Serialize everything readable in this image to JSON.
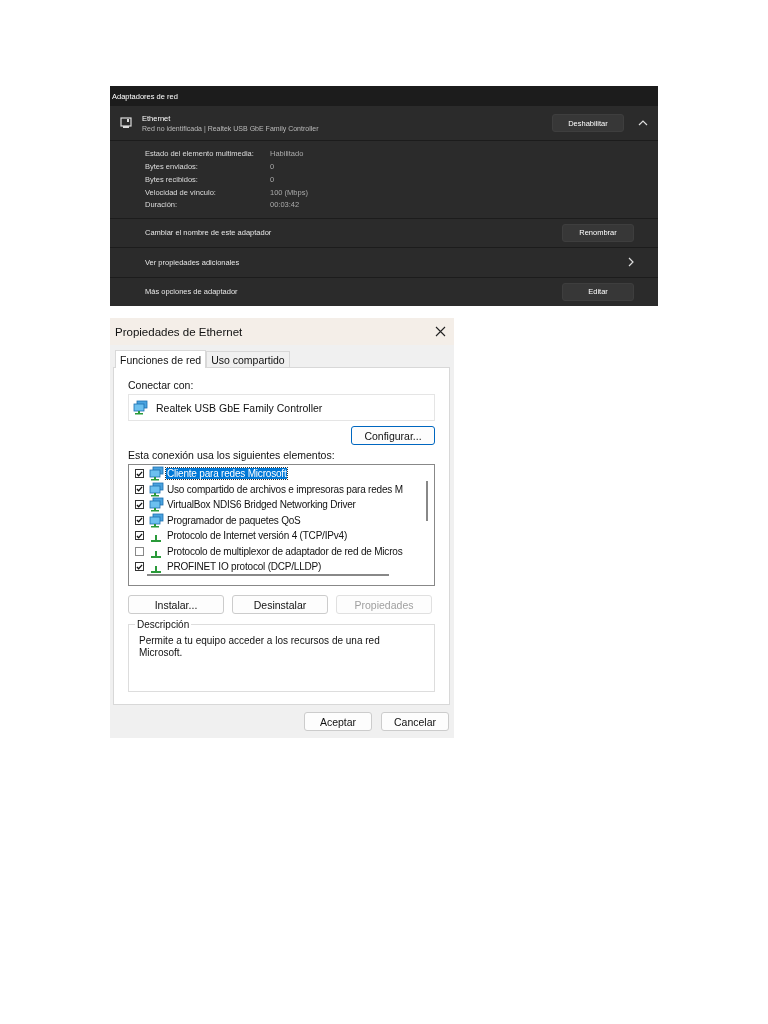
{
  "adapters_panel": {
    "title": "Adaptadores de red",
    "adapter": {
      "name": "Ethernet",
      "detail": "Red no identificada | Realtek USB GbE Family Controller",
      "button": "Deshabilitar",
      "expanded": true
    },
    "properties": [
      {
        "label": "Estado del elemento multimedia:",
        "value": "Habilitado"
      },
      {
        "label": "Bytes enviados:",
        "value": "0"
      },
      {
        "label": "Bytes recibidos:",
        "value": "0"
      },
      {
        "label": "Velocidad de vínculo:",
        "value": "100 (Mbps)"
      },
      {
        "label": "Duración:",
        "value": "00:03:42"
      }
    ],
    "actions": [
      {
        "kind": "button",
        "label": "Cambiar el nombre de este adaptador",
        "button": "Renombrar"
      },
      {
        "kind": "link",
        "label": "Ver propiedades adicionales"
      },
      {
        "kind": "button",
        "label": "Más opciones de adaptador",
        "button": "Editar"
      }
    ]
  },
  "dialog": {
    "title": "Propiedades de Ethernet",
    "tabs": [
      {
        "label": "Funciones de red",
        "selected": true
      },
      {
        "label": "Uso compartido",
        "selected": false
      }
    ],
    "connect_label": "Conectar con:",
    "adapter_name": "Realtek USB GbE Family Controller",
    "configure_button": "Configurar...",
    "items_label": "Esta conexión usa los siguientes elementos:",
    "items": [
      {
        "kind": "client",
        "label": "Cliente para redes Microsoft",
        "checked": true,
        "selected": true
      },
      {
        "kind": "client",
        "label": "Uso compartido de archivos e impresoras para redes M",
        "checked": true,
        "selected": false
      },
      {
        "kind": "client",
        "label": "VirtualBox NDIS6 Bridged Networking Driver",
        "checked": true,
        "selected": false
      },
      {
        "kind": "client",
        "label": "Programador de paquetes QoS",
        "checked": true,
        "selected": false
      },
      {
        "kind": "protocol",
        "label": "Protocolo de Internet versión 4 (TCP/IPv4)",
        "checked": true,
        "selected": false
      },
      {
        "kind": "protocol",
        "label": "Protocolo de multiplexor de adaptador de red de Micros",
        "checked": false,
        "selected": false
      },
      {
        "kind": "protocol",
        "label": "PROFINET IO protocol (DCP/LLDP)",
        "checked": true,
        "selected": false
      }
    ],
    "buttons": [
      {
        "label": "Instalar...",
        "disabled": false
      },
      {
        "label": "Desinstalar",
        "disabled": false
      },
      {
        "label": "Propiedades",
        "disabled": true
      }
    ],
    "description": {
      "title": "Descripción",
      "text": "Permite a tu equipo acceder a los recursos de una red Microsoft."
    },
    "footer_buttons": [
      "Aceptar",
      "Cancelar"
    ]
  }
}
